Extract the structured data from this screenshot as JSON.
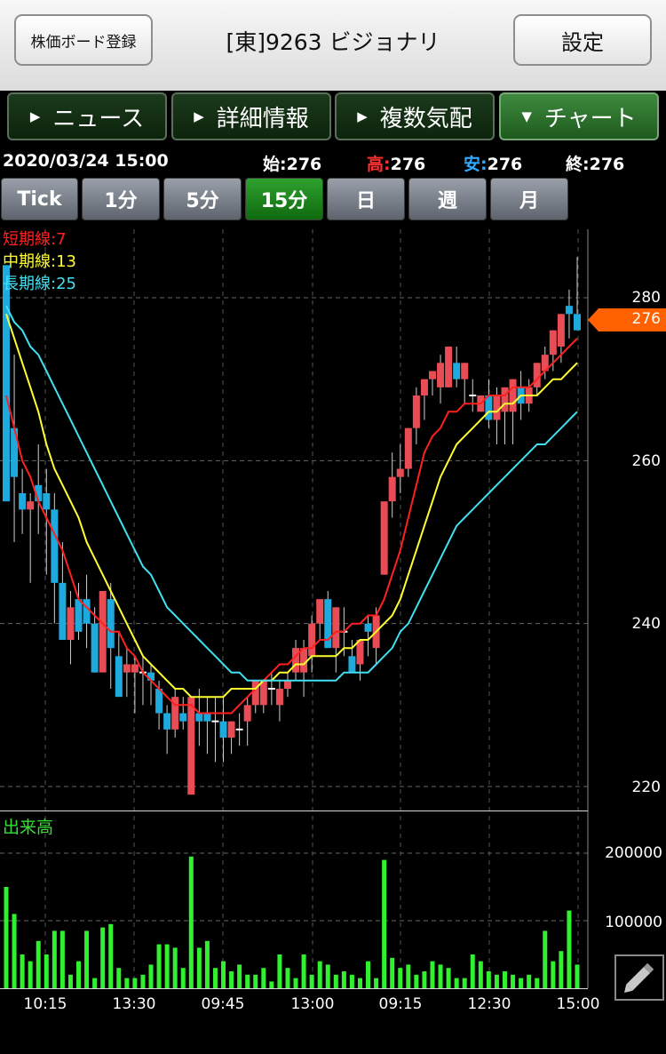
{
  "header": {
    "register_label": "株価ボード登録",
    "title": "[東]9263 ビジョナリ",
    "settings_label": "設定"
  },
  "tabs": [
    {
      "label": "ニュース",
      "icon": "triangle-right-icon"
    },
    {
      "label": "詳細情報",
      "icon": "triangle-right-icon"
    },
    {
      "label": "複数気配",
      "icon": "triangle-right-icon"
    },
    {
      "label": "チャート",
      "icon": "triangle-down-icon",
      "active": true
    }
  ],
  "quote": {
    "datetime": "2020/03/24 15:00",
    "open_label": "始:",
    "open": "276",
    "high_label": "高:",
    "high": "276",
    "low_label": "安:",
    "low": "276",
    "close_label": "終:",
    "close": "276"
  },
  "periods": [
    "Tick",
    "1分",
    "5分",
    "15分",
    "日",
    "週",
    "月"
  ],
  "active_period": "15分",
  "legend": [
    {
      "label": "短期線:7",
      "color": "#ff2020"
    },
    {
      "label": "中期線:13",
      "color": "#ffff30"
    },
    {
      "label": "長期線:25",
      "color": "#40e0f0"
    }
  ],
  "price_axis": [
    "280",
    "260",
    "240",
    "220"
  ],
  "current_price_tag": "276",
  "volume_label": "出来高",
  "volume_axis": [
    "200000",
    "100000"
  ],
  "x_axis_labels": [
    "10:15",
    "13:30",
    "09:45",
    "13:00",
    "09:15",
    "12:30",
    "15:00"
  ],
  "colors": {
    "up": "#e84c54",
    "down": "#1eaadc",
    "volume": "#30f030",
    "ma_short": "#ff2020",
    "ma_mid": "#ffff30",
    "ma_long": "#40e0f0",
    "price_tag": "#ff6000"
  },
  "chart_data": {
    "type": "candlestick",
    "price_ylim": [
      220,
      280
    ],
    "volume_ylim": [
      0,
      200000
    ],
    "x": [
      "10:15",
      "13:30",
      "09:45",
      "13:00",
      "09:15",
      "12:30",
      "15:00"
    ],
    "candles": [
      [
        284,
        282,
        264,
        255
      ],
      [
        264,
        273,
        250,
        258
      ],
      [
        256,
        259,
        251,
        254
      ],
      [
        254,
        256,
        245,
        255
      ],
      [
        257,
        262,
        251,
        255
      ],
      [
        256,
        259,
        246,
        254
      ],
      [
        254,
        256,
        240,
        245
      ],
      [
        245,
        250,
        238,
        238
      ],
      [
        238,
        244,
        235,
        242
      ],
      [
        243,
        245,
        238,
        239
      ],
      [
        243,
        246,
        237,
        240
      ],
      [
        240,
        242,
        234,
        234
      ],
      [
        234,
        244,
        235,
        244
      ],
      [
        243,
        245,
        232,
        237
      ],
      [
        236,
        239,
        233,
        231
      ],
      [
        234,
        237,
        231,
        235
      ],
      [
        234,
        236,
        229,
        235
      ],
      [
        234,
        236,
        230,
        234
      ],
      [
        234,
        235,
        230,
        233
      ],
      [
        232,
        233,
        227,
        229
      ],
      [
        229,
        230,
        224,
        227
      ],
      [
        227,
        232,
        226,
        231
      ],
      [
        229,
        231,
        227,
        228
      ],
      [
        219,
        231,
        219,
        231
      ],
      [
        229,
        232,
        225,
        228
      ],
      [
        229,
        231,
        224,
        228
      ],
      [
        228,
        231,
        223,
        228
      ],
      [
        228,
        231,
        223,
        226
      ],
      [
        226,
        228,
        224,
        228
      ],
      [
        227,
        229,
        225,
        227
      ],
      [
        228,
        231,
        225,
        230
      ],
      [
        230,
        233,
        229,
        233
      ],
      [
        230,
        233,
        229,
        233
      ],
      [
        232,
        234,
        230,
        232
      ],
      [
        230,
        233,
        228,
        232
      ],
      [
        232,
        234,
        231,
        233
      ],
      [
        234,
        238,
        233,
        237
      ],
      [
        234,
        238,
        231,
        237
      ],
      [
        236,
        241,
        234,
        240
      ],
      [
        240,
        242,
        238,
        243
      ],
      [
        243,
        244,
        237,
        237
      ],
      [
        237,
        242,
        234,
        242
      ],
      [
        239,
        242,
        236,
        239
      ],
      [
        236,
        238,
        234,
        234
      ],
      [
        235,
        238,
        233,
        238
      ],
      [
        240,
        241,
        236,
        239
      ],
      [
        237,
        242,
        235,
        241
      ],
      [
        246,
        249,
        246,
        255
      ],
      [
        255,
        261,
        253,
        258
      ],
      [
        258,
        262,
        256,
        259
      ],
      [
        259,
        264,
        258,
        264
      ],
      [
        264,
        269,
        262,
        268
      ],
      [
        268,
        270,
        265,
        270
      ],
      [
        270,
        271,
        268,
        271
      ],
      [
        269,
        273,
        267,
        272
      ],
      [
        269,
        274,
        269,
        274
      ],
      [
        272,
        274,
        269,
        270
      ],
      [
        270,
        272,
        267,
        272
      ],
      [
        268,
        270,
        266,
        268
      ],
      [
        266,
        268,
        266,
        268
      ],
      [
        268,
        270,
        264,
        265
      ],
      [
        265,
        269,
        262,
        268
      ],
      [
        266,
        269,
        262,
        269
      ],
      [
        266,
        270,
        262,
        270
      ],
      [
        269,
        271,
        265,
        267
      ],
      [
        267,
        270,
        266,
        269
      ],
      [
        269,
        272,
        268,
        272
      ],
      [
        271,
        274,
        270,
        273
      ],
      [
        273,
        276,
        271,
        276
      ],
      [
        274,
        278,
        272,
        278
      ],
      [
        279,
        281,
        275,
        278
      ],
      [
        278,
        285,
        278,
        276
      ]
    ],
    "ma_short": [
      268,
      264,
      260,
      258,
      255,
      253,
      251,
      249,
      246,
      243,
      242,
      241,
      240,
      239,
      239,
      237,
      236,
      234,
      233,
      232,
      231,
      230,
      230,
      230,
      229,
      229,
      229,
      229,
      229,
      230,
      231,
      232,
      233,
      234,
      235,
      235,
      236,
      237,
      237,
      238,
      238,
      239,
      239,
      240,
      240,
      241,
      241,
      243,
      246,
      249,
      253,
      257,
      261,
      263,
      264,
      266,
      266,
      267,
      267,
      267,
      268,
      268,
      268,
      269,
      269,
      269,
      270,
      271,
      272,
      273,
      274,
      275
    ],
    "ma_mid": [
      278,
      275,
      272,
      269,
      266,
      262,
      259,
      257,
      255,
      253,
      250,
      248,
      246,
      244,
      242,
      240,
      238,
      236,
      235,
      234,
      233,
      232,
      232,
      231,
      231,
      231,
      231,
      231,
      232,
      232,
      232,
      232,
      233,
      233,
      234,
      234,
      235,
      235,
      236,
      236,
      236,
      236,
      237,
      237,
      238,
      238,
      239,
      240,
      241,
      243,
      246,
      249,
      252,
      255,
      258,
      260,
      262,
      263,
      264,
      265,
      266,
      266,
      267,
      267,
      268,
      268,
      268,
      269,
      270,
      270,
      271,
      272
    ],
    "ma_long": [
      279,
      277,
      276,
      274,
      273,
      271,
      269,
      267,
      265,
      263,
      261,
      259,
      257,
      255,
      253,
      251,
      249,
      247,
      246,
      244,
      242,
      241,
      240,
      239,
      238,
      237,
      236,
      235,
      234,
      234,
      233,
      233,
      233,
      233,
      233,
      233,
      233,
      233,
      233,
      233,
      233,
      233,
      234,
      234,
      234,
      234,
      235,
      236,
      237,
      239,
      240,
      242,
      244,
      246,
      248,
      250,
      252,
      253,
      254,
      255,
      256,
      257,
      258,
      259,
      260,
      261,
      262,
      262,
      263,
      264,
      265,
      266
    ],
    "volume": [
      150000,
      110000,
      50000,
      40000,
      70000,
      50000,
      85000,
      85000,
      20000,
      40000,
      85000,
      15000,
      90000,
      95000,
      30000,
      15000,
      15000,
      20000,
      35000,
      65000,
      65000,
      60000,
      30000,
      195000,
      60000,
      70000,
      30000,
      40000,
      25000,
      35000,
      20000,
      20000,
      30000,
      10000,
      50000,
      30000,
      15000,
      50000,
      20000,
      40000,
      35000,
      20000,
      25000,
      20000,
      15000,
      40000,
      15000,
      190000,
      45000,
      30000,
      35000,
      20000,
      25000,
      40000,
      35000,
      30000,
      15000,
      15000,
      50000,
      40000,
      25000,
      20000,
      25000,
      20000,
      15000,
      20000,
      15000,
      85000,
      40000,
      55000,
      115000,
      35000
    ]
  }
}
